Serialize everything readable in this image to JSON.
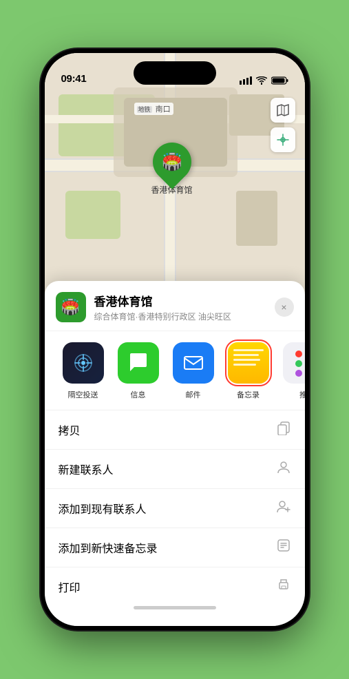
{
  "statusBar": {
    "time": "09:41",
    "locationArrow": "▶"
  },
  "map": {
    "label": "南口",
    "stadiumName": "香港体育馆",
    "pinEmoji": "🏟️"
  },
  "venueCard": {
    "name": "香港体育馆",
    "subtitle": "综合体育馆·香港特别行政区 油尖旺区",
    "icon": "🏟️",
    "closeLabel": "×"
  },
  "shareItems": [
    {
      "id": "airdrop",
      "label": "隔空投送",
      "emoji": "📡"
    },
    {
      "id": "messages",
      "label": "信息",
      "emoji": "💬"
    },
    {
      "id": "mail",
      "label": "邮件",
      "emoji": "✉️"
    },
    {
      "id": "notes",
      "label": "备忘录",
      "isNotes": true
    },
    {
      "id": "more",
      "label": "推",
      "isMore": true
    }
  ],
  "menuItems": [
    {
      "id": "copy",
      "label": "拷贝",
      "icon": "copy"
    },
    {
      "id": "new-contact",
      "label": "新建联系人",
      "icon": "person"
    },
    {
      "id": "add-existing",
      "label": "添加到现有联系人",
      "icon": "person-add"
    },
    {
      "id": "add-note",
      "label": "添加到新快速备忘录",
      "icon": "note"
    },
    {
      "id": "print",
      "label": "打印",
      "icon": "printer"
    }
  ]
}
